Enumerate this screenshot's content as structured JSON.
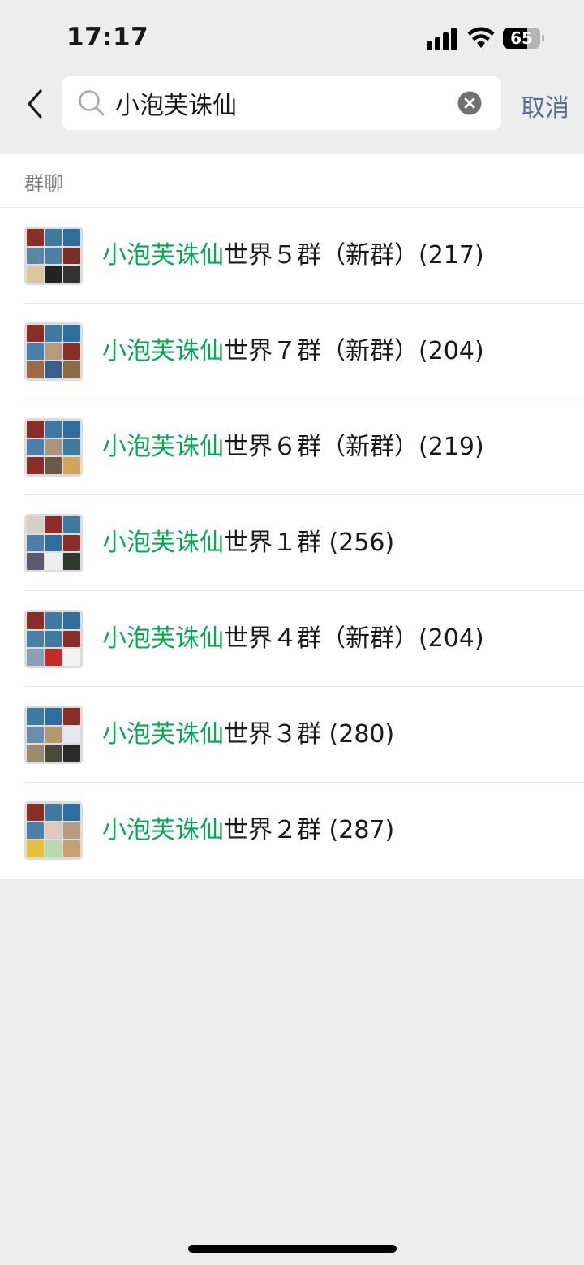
{
  "status_bar": {
    "time": "17:17",
    "battery": "65",
    "battery_level": 0.65
  },
  "search": {
    "query": "小泡芙诛仙",
    "cancel_label": "取消"
  },
  "section": {
    "title": "群聊"
  },
  "groups": [
    {
      "highlight": "小泡芙诛仙",
      "rest": "世界５群（新群）(217)",
      "avatar": [
        "#8a2e2a",
        "#3f7aa0",
        "#2f6e9c",
        "#5a86a6",
        "#4b7fa8",
        "#7a2f2a",
        "#d9c69a",
        "#222222",
        "#333333"
      ]
    },
    {
      "highlight": "小泡芙诛仙",
      "rest": "世界７群（新群）(204)",
      "avatar": [
        "#8a2e2a",
        "#3f7aa0",
        "#2f6e9c",
        "#4b7fa8",
        "#b59a7e",
        "#8a2e2a",
        "#9b6a4a",
        "#3a5f8a",
        "#8b6b4a"
      ]
    },
    {
      "highlight": "小泡芙诛仙",
      "rest": "世界６群（新群）(219)",
      "avatar": [
        "#8a2e2a",
        "#3f7aa0",
        "#2f6e9c",
        "#4b7fa8",
        "#a8957e",
        "#3f7aa0",
        "#8a2e2a",
        "#6b5a4a",
        "#d2a35a"
      ]
    },
    {
      "highlight": "小泡芙诛仙",
      "rest": "世界１群 (256)",
      "avatar": [
        "#d8d0c4",
        "#8a2e2a",
        "#3f7aa0",
        "#4b7fa8",
        "#2f6e9c",
        "#8a2e2a",
        "#5b5a6e",
        "#eeeeee",
        "#2f3a2e"
      ]
    },
    {
      "highlight": "小泡芙诛仙",
      "rest": "世界４群（新群）(204)",
      "avatar": [
        "#8a2e2a",
        "#3f7aa0",
        "#2f6e9c",
        "#4b7fa8",
        "#3f7aa0",
        "#8a2e2a",
        "#8aa0b4",
        "#c52a2a",
        "#f4f4f4"
      ]
    },
    {
      "highlight": "小泡芙诛仙",
      "rest": "世界３群 (280)",
      "avatar": [
        "#3f7aa0",
        "#2f6e9c",
        "#8a2e2a",
        "#6a8db0",
        "#b29a6e",
        "#e8e8f0",
        "#9b8a6e",
        "#4a4a3a",
        "#2a2a2a"
      ]
    },
    {
      "highlight": "小泡芙诛仙",
      "rest": "世界２群 (287)",
      "avatar": [
        "#8a2e2a",
        "#3f7aa0",
        "#2f6e9c",
        "#4b7fa8",
        "#e0c8c0",
        "#b59a80",
        "#e8c040",
        "#b8d8b0",
        "#c8a070"
      ]
    }
  ]
}
